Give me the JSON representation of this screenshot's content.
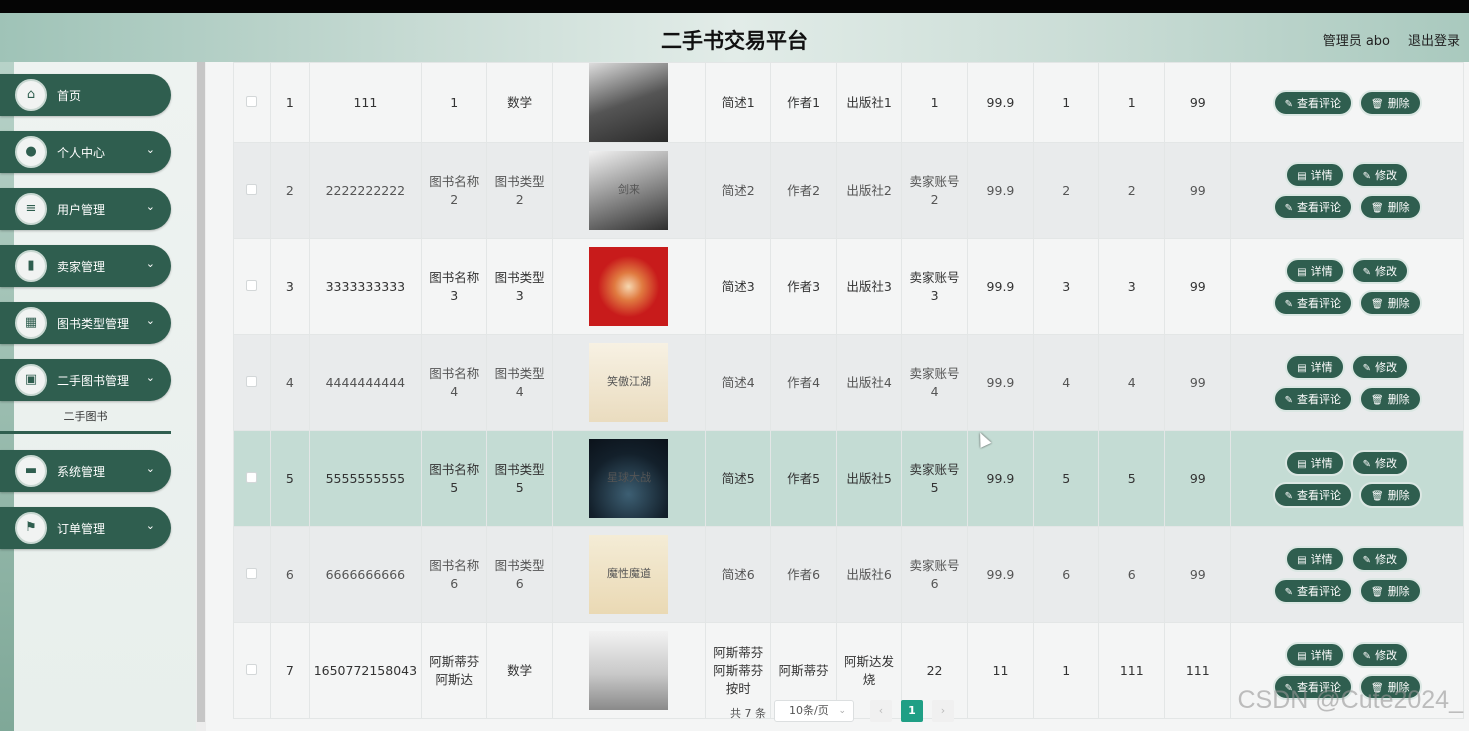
{
  "header": {
    "title": "二手书交易平台",
    "user": "管理员 abo",
    "logout": "退出登录"
  },
  "sidebar": {
    "items": [
      {
        "label": "首页",
        "icon": "home-icon",
        "glyph": "⌂",
        "chevron": ""
      },
      {
        "label": "个人中心",
        "icon": "user-icon",
        "glyph": "●",
        "chevron": "⌄"
      },
      {
        "label": "用户管理",
        "icon": "list-icon",
        "glyph": "≡",
        "chevron": "⌄"
      },
      {
        "label": "卖家管理",
        "icon": "bar-chart-icon",
        "glyph": "▮",
        "chevron": "⌄"
      },
      {
        "label": "图书类型管理",
        "icon": "grid-icon",
        "glyph": "▦",
        "chevron": "⌄"
      },
      {
        "label": "二手图书管理",
        "icon": "clipboard-icon",
        "glyph": "▣",
        "chevron": "⌄"
      },
      {
        "label": "系统管理",
        "icon": "chat-icon",
        "glyph": "▬",
        "chevron": "⌄"
      },
      {
        "label": "订单管理",
        "icon": "flag-icon",
        "glyph": "⚑",
        "chevron": "⌄"
      }
    ],
    "submenu": "二手图书"
  },
  "buttons": {
    "detail": "详情",
    "edit": "修改",
    "comments": "查看评论",
    "delete": "删除"
  },
  "table": {
    "rows": [
      {
        "no": "1",
        "code": "111",
        "name": "1",
        "type": "数学",
        "cover": "",
        "desc": "简述1",
        "author": "作者1",
        "publisher": "出版社1",
        "seller": "1",
        "price": "99.9",
        "c1": "1",
        "c2": "1",
        "c3": "99"
      },
      {
        "no": "2",
        "code": "2222222222",
        "name": "图书名称2",
        "type": "图书类型2",
        "cover": "剑来",
        "desc": "简述2",
        "author": "作者2",
        "publisher": "出版社2",
        "seller": "卖家账号2",
        "price": "99.9",
        "c1": "2",
        "c2": "2",
        "c3": "99"
      },
      {
        "no": "3",
        "code": "3333333333",
        "name": "图书名称3",
        "type": "图书类型3",
        "cover": "",
        "desc": "简述3",
        "author": "作者3",
        "publisher": "出版社3",
        "seller": "卖家账号3",
        "price": "99.9",
        "c1": "3",
        "c2": "3",
        "c3": "99"
      },
      {
        "no": "4",
        "code": "4444444444",
        "name": "图书名称4",
        "type": "图书类型4",
        "cover": "笑傲江湖",
        "desc": "简述4",
        "author": "作者4",
        "publisher": "出版社4",
        "seller": "卖家账号4",
        "price": "99.9",
        "c1": "4",
        "c2": "4",
        "c3": "99"
      },
      {
        "no": "5",
        "code": "5555555555",
        "name": "图书名称5",
        "type": "图书类型5",
        "cover": "星球大战",
        "desc": "简述5",
        "author": "作者5",
        "publisher": "出版社5",
        "seller": "卖家账号5",
        "price": "99.9",
        "c1": "5",
        "c2": "5",
        "c3": "99"
      },
      {
        "no": "6",
        "code": "6666666666",
        "name": "图书名称6",
        "type": "图书类型6",
        "cover": "魔性魔道",
        "desc": "简述6",
        "author": "作者6",
        "publisher": "出版社6",
        "seller": "卖家账号6",
        "price": "99.9",
        "c1": "6",
        "c2": "6",
        "c3": "99"
      },
      {
        "no": "7",
        "code": "1650772158043",
        "name": "阿斯蒂芬阿斯达",
        "type": "数学",
        "cover": "",
        "desc": "阿斯蒂芬阿斯蒂芬按时",
        "author": "阿斯蒂芬",
        "publisher": "阿斯达发烧",
        "seller": "22",
        "price": "11",
        "c1": "1",
        "c2": "111",
        "c3": "111"
      }
    ]
  },
  "pagination": {
    "total": "共 7 条",
    "page_size": "10条/页",
    "current": "1",
    "prev": "‹",
    "next": "›"
  },
  "watermark": "CSDN @Cute2024_"
}
